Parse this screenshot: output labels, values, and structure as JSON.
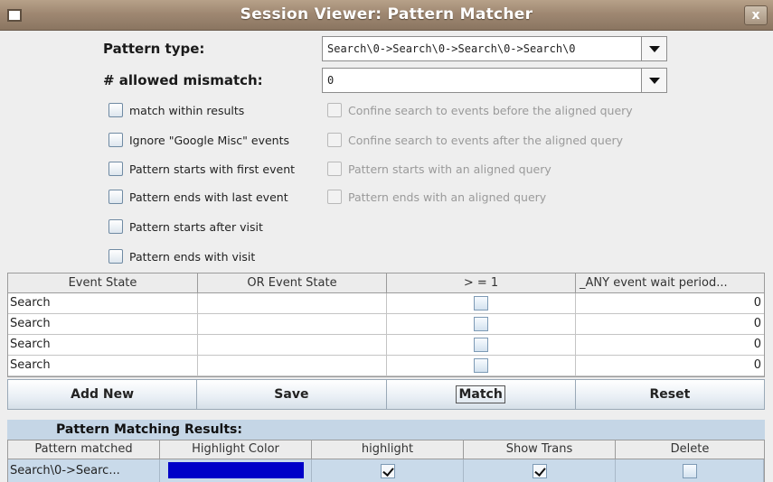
{
  "window": {
    "title": "Session Viewer: Pattern Matcher",
    "close_label": "x"
  },
  "form": {
    "pattern_type_label": "Pattern type:",
    "pattern_type_value": "Search\\0->Search\\0->Search\\0->Search\\0",
    "mismatch_label": "# allowed mismatch:",
    "mismatch_value": "0"
  },
  "options_left": [
    {
      "label": "match within results",
      "checked": false
    },
    {
      "label": "Ignore \"Google Misc\" events",
      "checked": false
    },
    {
      "label": "Pattern starts with first event",
      "checked": false
    },
    {
      "label": "Pattern ends with last event",
      "checked": false
    },
    {
      "label": "Pattern starts after visit",
      "checked": false
    },
    {
      "label": "Pattern ends with visit",
      "checked": false
    }
  ],
  "options_right": [
    {
      "label": "Confine search to events before the aligned query",
      "enabled": false
    },
    {
      "label": "Confine search to events after the aligned query",
      "enabled": false
    },
    {
      "label": "Pattern starts with an aligned query",
      "enabled": false
    },
    {
      "label": "Pattern ends with an aligned query",
      "enabled": false
    }
  ],
  "event_table": {
    "columns": [
      "Event State",
      "OR Event State",
      "> = 1",
      "_ANY event wait period..."
    ],
    "rows": [
      {
        "event_state": "Search",
        "or_event_state": "",
        "at_least_one": false,
        "wait_period": "0"
      },
      {
        "event_state": "Search",
        "or_event_state": "",
        "at_least_one": false,
        "wait_period": "0"
      },
      {
        "event_state": "Search",
        "or_event_state": "",
        "at_least_one": false,
        "wait_period": "0"
      },
      {
        "event_state": "Search",
        "or_event_state": "",
        "at_least_one": false,
        "wait_period": "0"
      }
    ]
  },
  "buttons": {
    "add_new": "Add New",
    "save": "Save",
    "match": "Match",
    "reset": "Reset"
  },
  "results": {
    "header": "Pattern Matching Results:",
    "columns": [
      "Pattern matched",
      "Highlight Color",
      "highlight",
      "Show Trans",
      "Delete"
    ],
    "rows": [
      {
        "pattern": "Search\\0->Searc...",
        "color": "#0000c8",
        "highlight": true,
        "show_trans": true,
        "delete": false
      }
    ]
  }
}
